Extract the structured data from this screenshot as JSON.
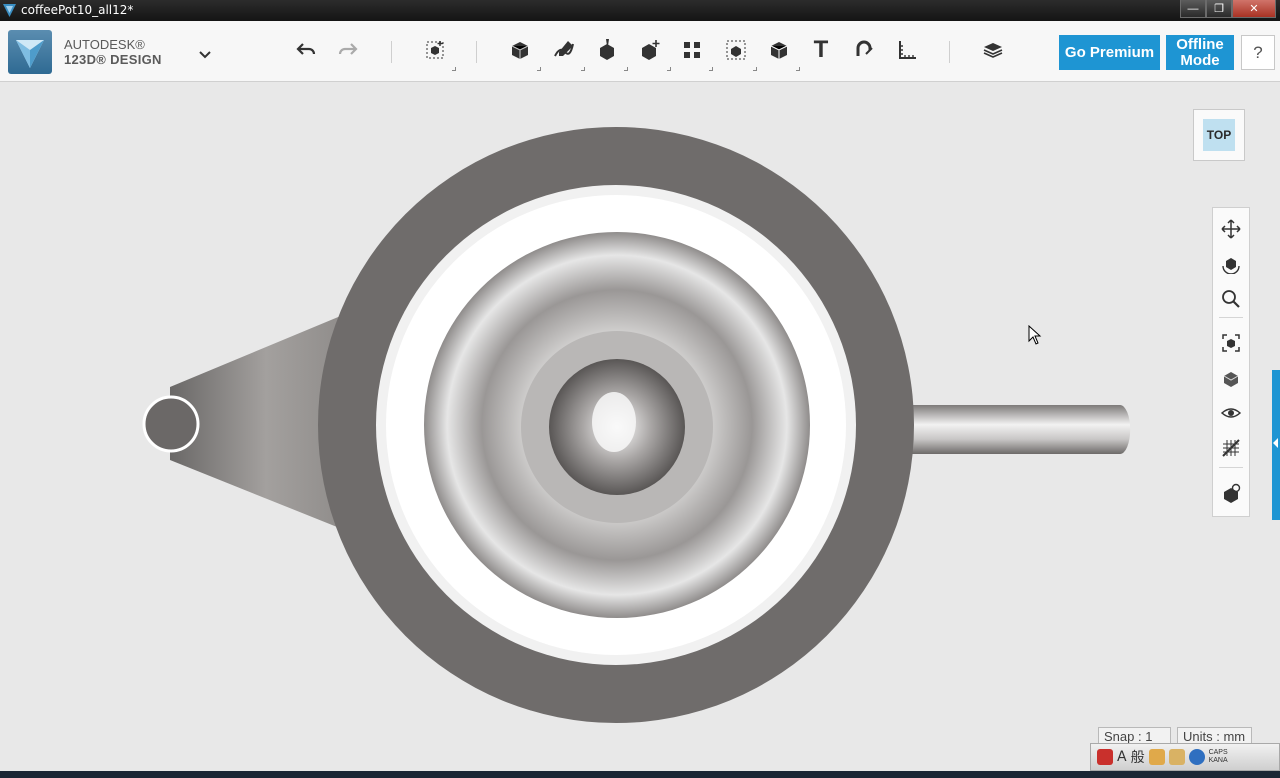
{
  "window": {
    "title": "coffeePot10_all12*",
    "minimize_glyph": "—",
    "maximize_glyph": "❐",
    "close_glyph": "✕"
  },
  "app": {
    "brand_line1": "AUTODESK®",
    "brand_line2": "123D® DESIGN",
    "menu_icon": "chevron-down-icon"
  },
  "toolbar": {
    "tools": [
      {
        "name": "undo-icon"
      },
      {
        "name": "redo-icon"
      },
      {
        "name": "transform-icon"
      },
      {
        "name": "primitives-icon"
      },
      {
        "name": "sketch-icon"
      },
      {
        "name": "construct-icon"
      },
      {
        "name": "modify-icon"
      },
      {
        "name": "pattern-icon"
      },
      {
        "name": "grouping-icon"
      },
      {
        "name": "combine-icon"
      },
      {
        "name": "text-icon"
      },
      {
        "name": "snap-icon"
      },
      {
        "name": "measure-icon"
      },
      {
        "name": "material-icon"
      }
    ],
    "text_tool_label": "T",
    "go_premium": "Go Premium",
    "offline_line1": "Offline",
    "offline_line2": "Mode",
    "help": "?"
  },
  "viewcube": {
    "face": "TOP"
  },
  "navbar": {
    "items": [
      "pan-icon",
      "orbit-icon",
      "zoom-icon",
      "fit-icon",
      "view-material-icon",
      "visibility-icon",
      "grid-icon",
      "snap-view-icon"
    ]
  },
  "status": {
    "snap": "Snap : 1",
    "units": "Units : mm"
  },
  "tray": {
    "ime_a": "A",
    "ime_mode": "般",
    "caps": "CAPS",
    "kana": "KANA"
  },
  "colors": {
    "accent": "#1e95d3",
    "viewport_bg": "#e8e8e8",
    "model_gray": "#6f6c6b"
  }
}
